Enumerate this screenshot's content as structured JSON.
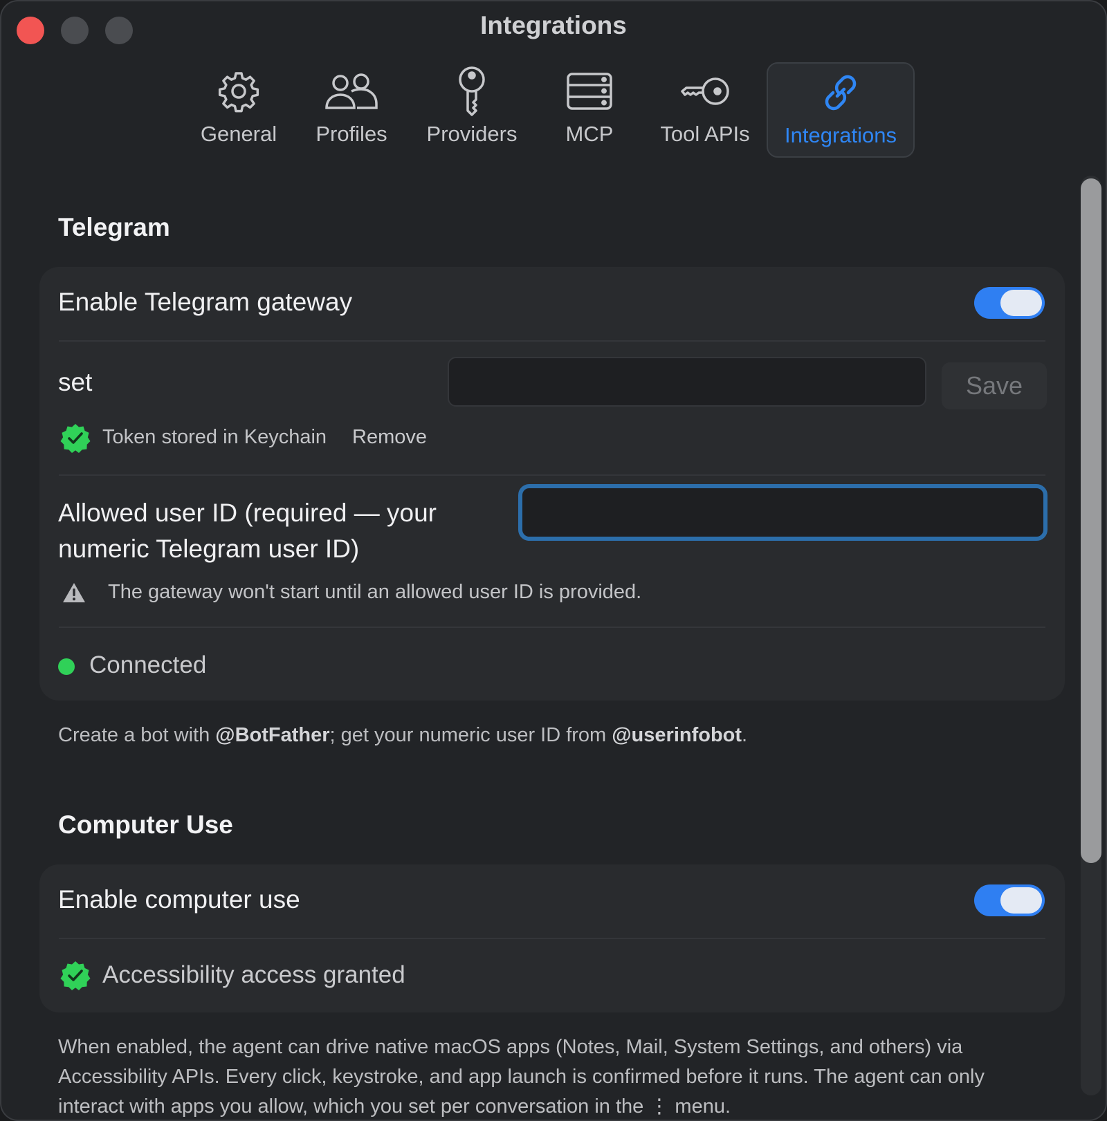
{
  "window": {
    "title": "Integrations"
  },
  "tabs": [
    {
      "label": "General",
      "icon": "gear-icon"
    },
    {
      "label": "Profiles",
      "icon": "users-icon"
    },
    {
      "label": "Providers",
      "icon": "key-icon"
    },
    {
      "label": "MCP",
      "icon": "server-icon"
    },
    {
      "label": "Tool APIs",
      "icon": "tool-key-icon"
    },
    {
      "label": "Integrations",
      "icon": "link-icon",
      "active": true
    }
  ],
  "colors": {
    "accent": "#2f86f4",
    "success": "#30d158",
    "close": "#f25553"
  },
  "telegram": {
    "title": "Telegram",
    "enable_label": "Enable Telegram gateway",
    "enabled": true,
    "token_label": "set",
    "token_value": "",
    "save_label": "Save",
    "token_status": "Token stored in Keychain",
    "remove_label": "Remove",
    "user_id_label": "Allowed user ID (required — your numeric Telegram user ID)",
    "user_id_value": "",
    "warning": "The gateway won't start until an allowed user ID is provided.",
    "connection_status": "Connected",
    "footnote_prefix": "Create a bot with ",
    "footnote_botfather": "@BotFather",
    "footnote_middle": "; get your numeric user ID from ",
    "footnote_userinfobot": "@userinfobot",
    "footnote_suffix": "."
  },
  "computer_use": {
    "title": "Computer Use",
    "enable_label": "Enable computer use",
    "enabled": true,
    "access_status": "Accessibility access granted",
    "footnote": "When enabled, the agent can drive native macOS apps (Notes, Mail, System Settings, and others) via Accessibility APIs. Every click, keystroke, and app launch is confirmed before it runs. The agent can only interact with apps you allow, which you set per conversation in the ⋮ menu."
  }
}
